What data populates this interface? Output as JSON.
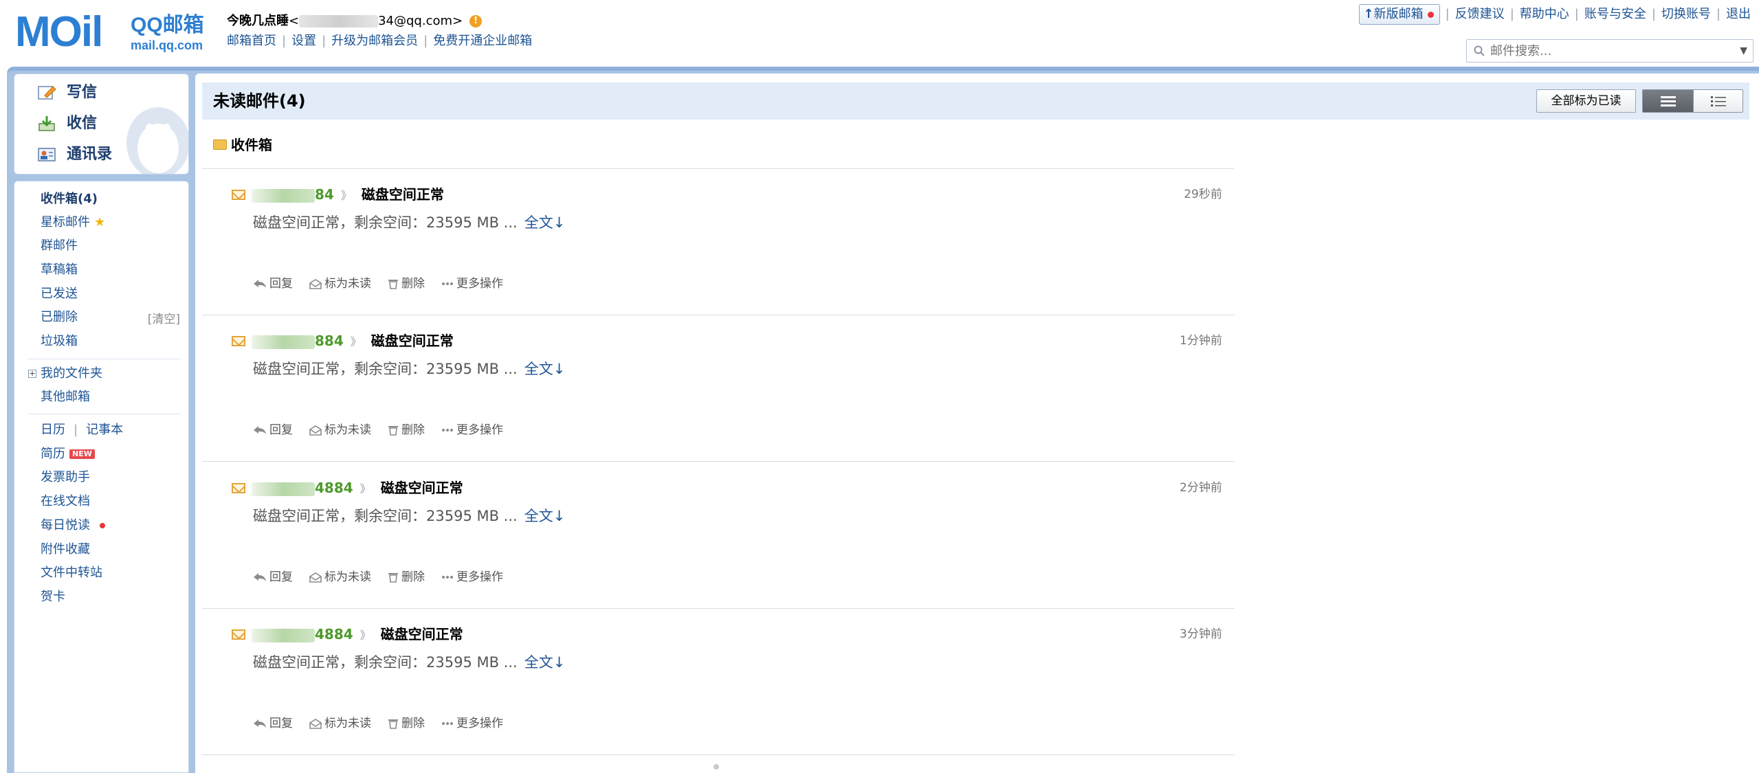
{
  "logo": {
    "mark": "MOil",
    "brand": "QQ邮箱",
    "sub": "mail.qq.com"
  },
  "user": {
    "name": "今晚几点睡",
    "email_prefix": "<",
    "email_suffix": "34@qq.com>",
    "warn": "!"
  },
  "topnav": [
    "邮箱首页",
    "设置",
    "升级为邮箱会员",
    "免费开通企业邮箱"
  ],
  "rightlinks": {
    "newver": "新版邮箱",
    "items": [
      "反馈建议",
      "帮助中心",
      "账号与安全",
      "切换账号",
      "退出"
    ]
  },
  "search": {
    "placeholder": "邮件搜索..."
  },
  "actions": [
    {
      "label": "写信",
      "icon": "compose-icon"
    },
    {
      "label": "收信",
      "icon": "receive-icon"
    },
    {
      "label": "通讯录",
      "icon": "contacts-icon"
    }
  ],
  "folders": {
    "inbox": "收件箱(4)",
    "starred": "星标邮件",
    "group": "群邮件",
    "drafts": "草稿箱",
    "sent": "已发送",
    "deleted": "已删除",
    "clear": "[清空]",
    "spam": "垃圾箱",
    "myfolders": "我的文件夹",
    "othermail": "其他邮箱",
    "calendar": "日历",
    "notes": "记事本",
    "resume": "简历",
    "resume_tag": "NEW",
    "invoice": "发票助手",
    "docs": "在线文档",
    "daily": "每日悦读",
    "attachments": "附件收藏",
    "transfer": "文件中转站",
    "cards": "贺卡"
  },
  "main": {
    "title": "未读邮件(4)",
    "markall": "全部标为已读",
    "inbox_label": "收件箱"
  },
  "mail_actions": {
    "reply": "回复",
    "mark_unread": "标为未读",
    "delete": "删除",
    "more": "更多操作"
  },
  "mails": [
    {
      "sender_tail": "84",
      "subject": "磁盘空间正常",
      "time": "29秒前",
      "preview": "磁盘空间正常，剩余空间：23595 MB  ...",
      "full": "全文↓"
    },
    {
      "sender_tail": "884",
      "subject": "磁盘空间正常",
      "time": "1分钟前",
      "preview": "磁盘空间正常，剩余空间：23595 MB  ...",
      "full": "全文↓"
    },
    {
      "sender_tail": "4884",
      "subject": "磁盘空间正常",
      "time": "2分钟前",
      "preview": "磁盘空间正常，剩余空间：23595 MB  ...",
      "full": "全文↓"
    },
    {
      "sender_tail": "4884",
      "subject": "磁盘空间正常",
      "time": "3分钟前",
      "preview": "磁盘空间正常，剩余空间：23595 MB  ...",
      "full": "全文↓"
    }
  ],
  "colors": {
    "accent": "#1e5494",
    "frame": "#a9c3e3",
    "sender": "#4c9a2a",
    "titlebar": "#e1ecf8"
  }
}
